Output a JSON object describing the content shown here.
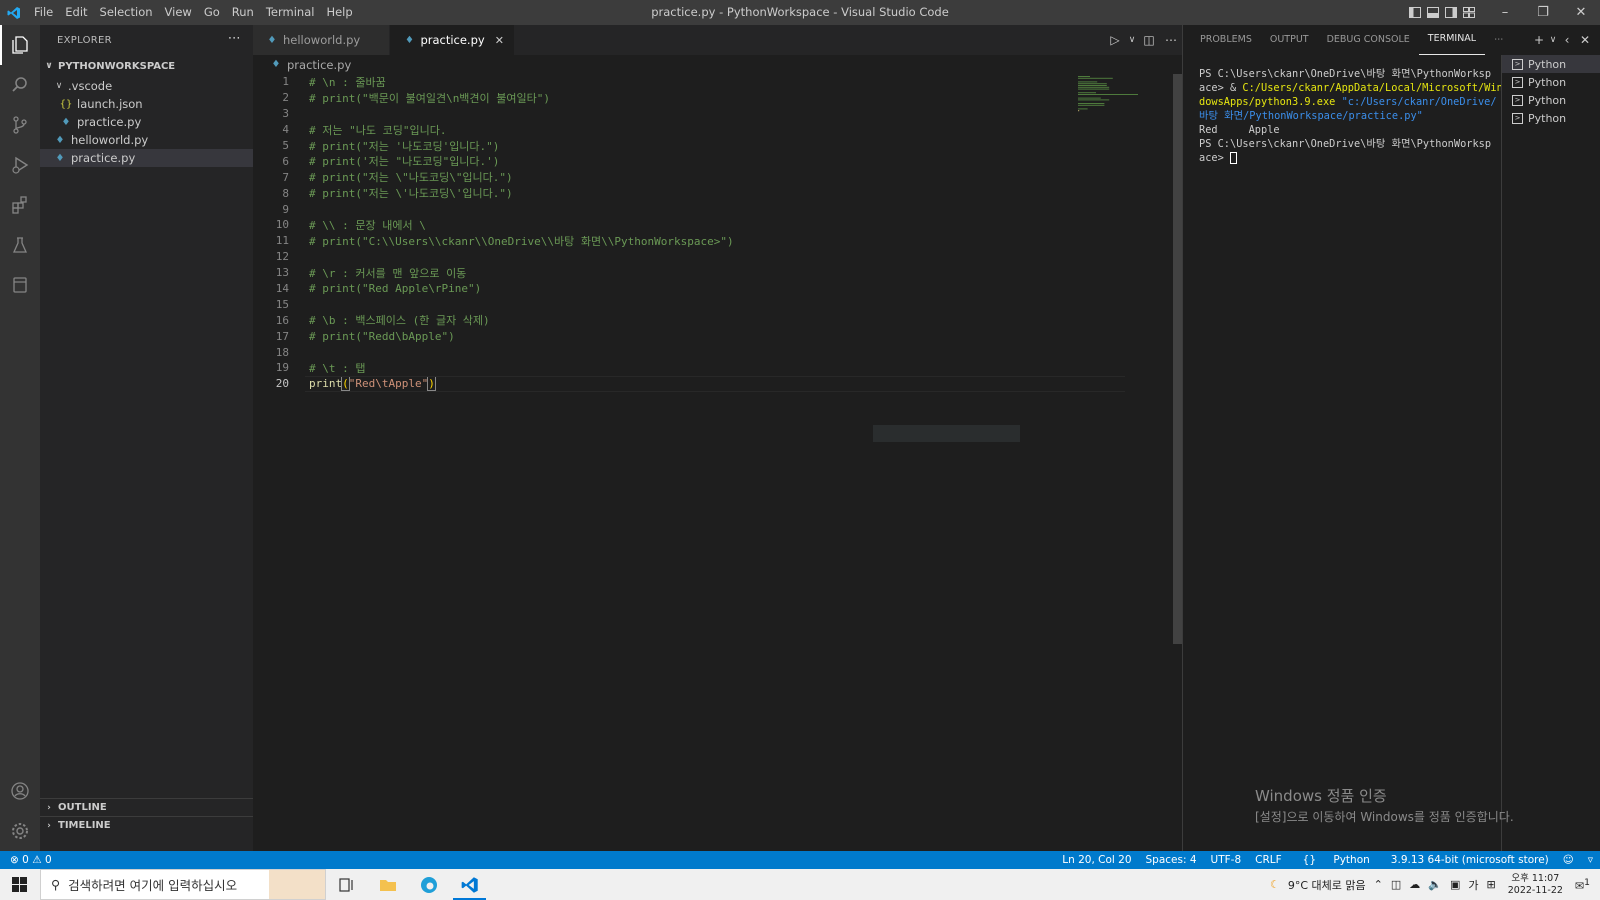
{
  "titlebar": {
    "menu": [
      "File",
      "Edit",
      "Selection",
      "View",
      "Go",
      "Run",
      "Terminal",
      "Help"
    ],
    "title": "practice.py - PythonWorkspace - Visual Studio Code"
  },
  "sidebar": {
    "header": "EXPLORER",
    "workspace": "PYTHONWORKSPACE",
    "tree": {
      "vscode_folder": ".vscode",
      "launch_json": "launch.json",
      "vscode_practice": "practice.py",
      "helloworld": "helloworld.py",
      "practice": "practice.py"
    },
    "outline": "OUTLINE",
    "timeline": "TIMELINE"
  },
  "editor": {
    "tabs": [
      {
        "label": "helloworld.py"
      },
      {
        "label": "practice.py"
      }
    ],
    "breadcrumb": "practice.py",
    "lines": [
      "# \\n : 줄바꿈",
      "# print(\"백문이 불여일견\\n백견이 불여일타\")",
      "",
      "# 저는 \"나도 코딩\"입니다.",
      "# print(\"저는 '나도코딩'입니다.\")",
      "# print('저는 \"나도코딩\"입니다.')",
      "# print(\"저는 \\\"나도코딩\\\"입니다.\")",
      "# print(\"저는 \\'나도코딩\\'입니다.\")",
      "",
      "# \\\\ : 문장 내에서 \\",
      "# print(\"C:\\\\Users\\\\ckanr\\\\OneDrive\\\\바탕 화면\\\\PythonWorkspace>\")",
      "",
      "# \\r : 커서를 맨 앞으로 이동",
      "# print(\"Red Apple\\rPine\")",
      "",
      "# \\b : 백스페이스 (한 글자 삭제)",
      "# print(\"Redd\\bApple\")",
      "",
      "# \\t : 탭"
    ],
    "line20": {
      "fn": "print",
      "open": "(",
      "str": "\"Red\\tApple\"",
      "close": ")"
    },
    "line_numbers": [
      "1",
      "2",
      "3",
      "4",
      "5",
      "6",
      "7",
      "8",
      "9",
      "10",
      "11",
      "12",
      "13",
      "14",
      "15",
      "16",
      "17",
      "18",
      "19",
      "20"
    ]
  },
  "panel": {
    "tabs": [
      "PROBLEMS",
      "OUTPUT",
      "DEBUG CONSOLE",
      "TERMINAL"
    ],
    "terminal": {
      "l1": "PS C:\\Users\\ckanr\\OneDrive\\바탕 화면\\PythonWorksp",
      "l2a": "ace> & ",
      "l2b": "C:/Users/ckanr/AppData/Local/Microsoft/Win",
      "l3a": "dowsApps/python3.9.exe",
      "l3b": " \"c:/Users/ckanr/OneDrive/",
      "l4": "바탕 화면/PythonWorkspace/practice.py\"",
      "l5": "Red     Apple",
      "l6": "PS C:\\Users\\ckanr\\OneDrive\\바탕 화면\\PythonWorksp",
      "l7": "ace> "
    },
    "terminal_list": [
      "Python",
      "Python",
      "Python",
      "Python"
    ],
    "activation_title": "Windows 정품 인증",
    "activation_sub": "[설정]으로 이동하여 Windows를 정품 인증합니다."
  },
  "status": {
    "errors": "0",
    "warnings": "0",
    "position": "Ln 20, Col 20",
    "spaces": "Spaces: 4",
    "encoding": "UTF-8",
    "eol": "CRLF",
    "language": "Python",
    "interpreter": "3.9.13 64-bit (microsoft store)"
  },
  "taskbar": {
    "search_placeholder": "검색하려면 여기에 입력하십시오",
    "weather": "9°C  대체로 맑음",
    "ime": "가",
    "time": "오후 11:07",
    "date": "2022-11-22",
    "notif_count": "1"
  },
  "colors": {
    "accent": "#007acc",
    "comment": "#6a9955",
    "string": "#ce9178",
    "function": "#dcdcaa"
  }
}
